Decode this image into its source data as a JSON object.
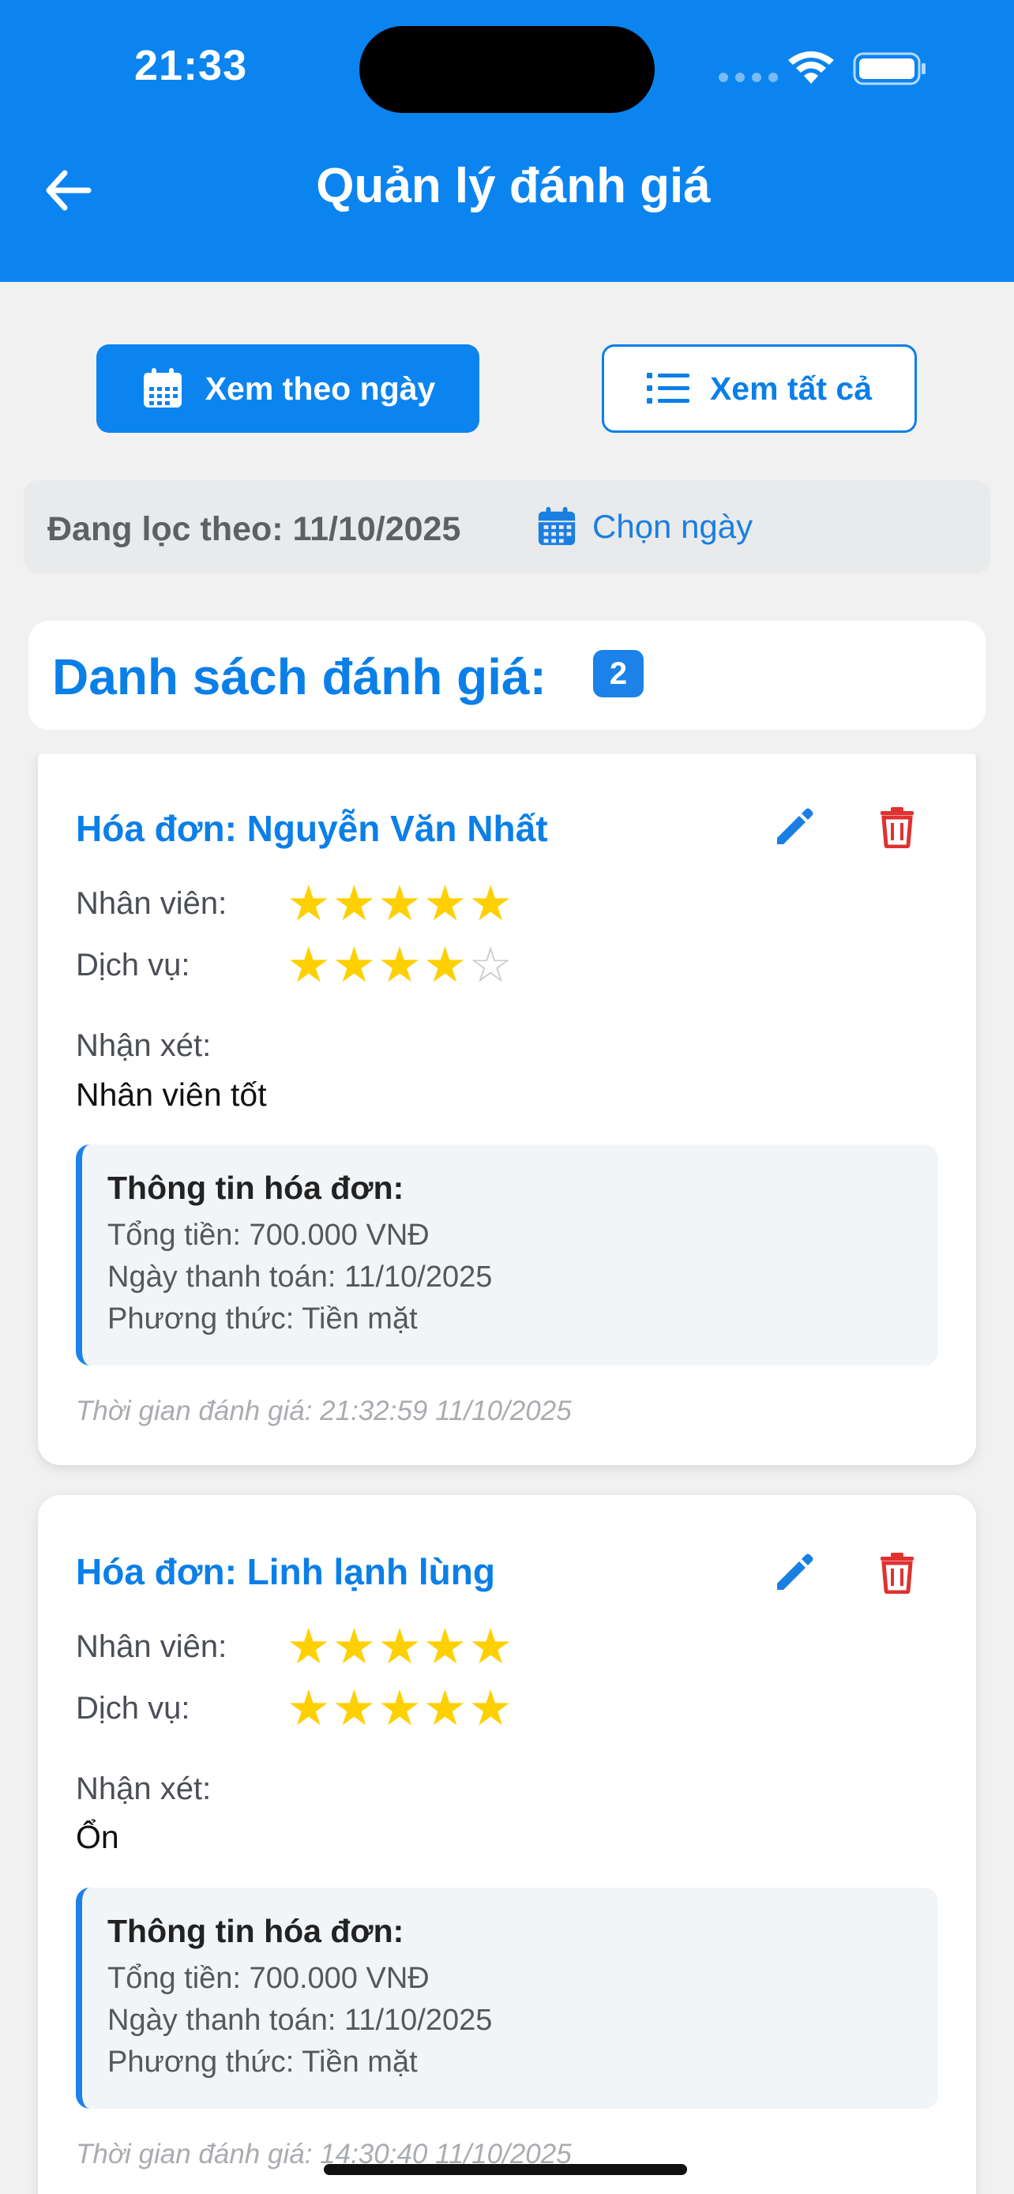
{
  "status_bar": {
    "time": "21:33"
  },
  "header": {
    "title": "Quản lý đánh giá",
    "back_icon": "arrow-left-icon"
  },
  "tabs": {
    "by_day": {
      "label": "Xem theo ngày",
      "icon": "calendar-icon",
      "active": true
    },
    "all": {
      "label": "Xem tất cả",
      "icon": "list-icon",
      "active": false
    }
  },
  "filter": {
    "label": "Đang lọc theo: 11/10/2025",
    "choose_date": "Chọn ngày"
  },
  "list": {
    "title": "Danh sách đánh giá:",
    "count": "2"
  },
  "labels": {
    "staff": "Nhân viên:",
    "service": "Dịch vụ:",
    "comment": "Nhận xét:",
    "invoice_info": "Thông tin hóa đơn:"
  },
  "reviews": [
    {
      "title": "Hóa đơn: Nguyễn Văn Nhất",
      "staff_rating": 5,
      "service_rating": 4,
      "comment": "Nhân viên tốt",
      "total": "Tổng tiền: 700.000 VNĐ",
      "paid_date": "Ngày thanh toán: 11/10/2025",
      "method": "Phương thức: Tiền mặt",
      "rated_time": "Thời gian đánh giá: 21:32:59 11/10/2025"
    },
    {
      "title": "Hóa đơn: Linh lạnh lùng",
      "staff_rating": 5,
      "service_rating": 5,
      "comment": "Ổn",
      "total": "Tổng tiền: 700.000 VNĐ",
      "paid_date": "Ngày thanh toán: 11/10/2025",
      "method": "Phương thức: Tiền mặt",
      "rated_time": "Thời gian đánh giá: 14:30:40 11/10/2025"
    }
  ],
  "colors": {
    "primary": "#0b84f0",
    "delete": "#e0312f",
    "star": "#ffd000",
    "star_empty": "#c9c9c9"
  }
}
